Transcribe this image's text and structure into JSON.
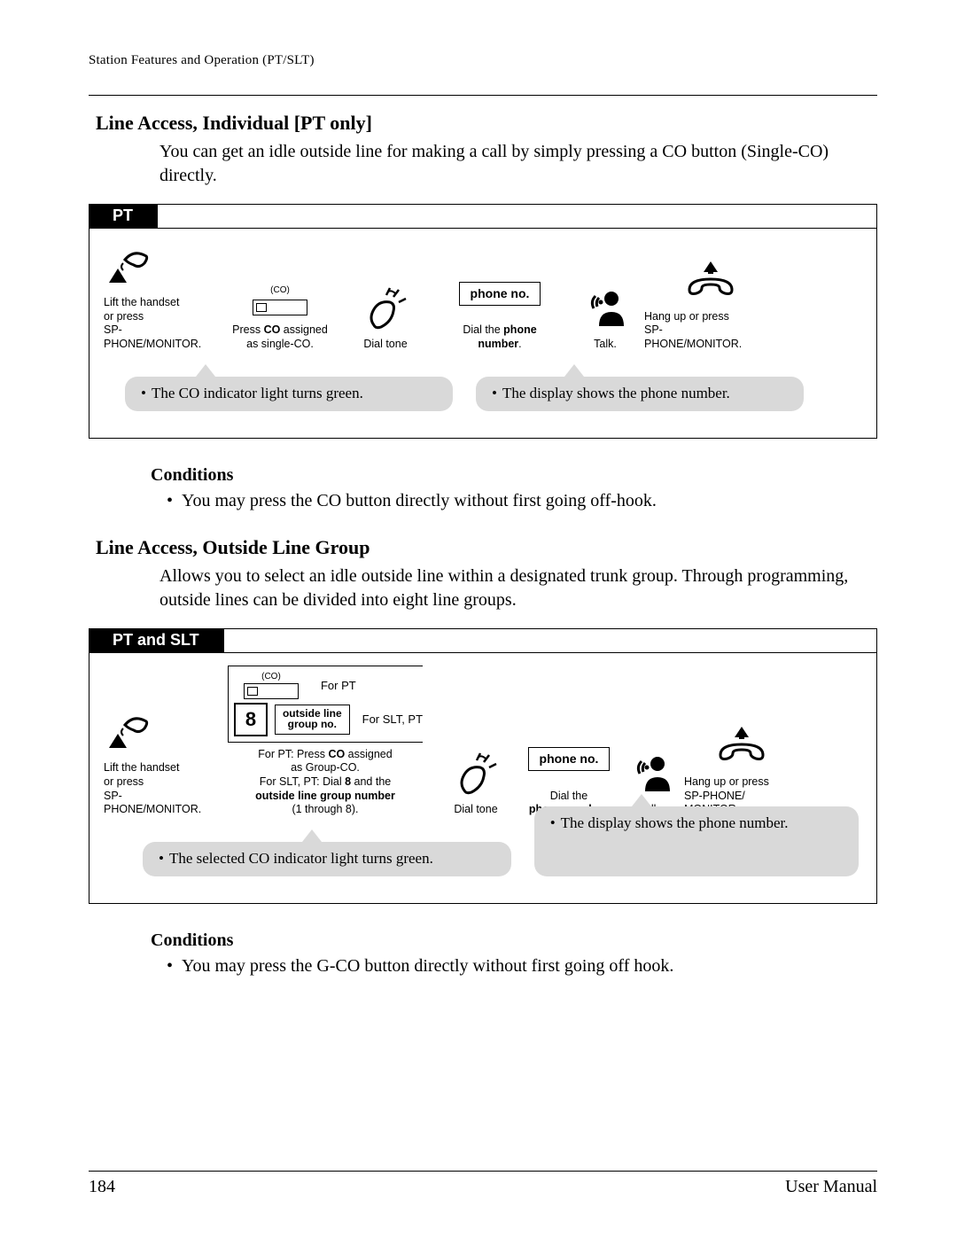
{
  "runhead": "Station Features and Operation (PT/SLT)",
  "sec1": {
    "title": "Line Access, Individual [PT only]",
    "intro": "You can get an idle outside line for making a call by simply pressing a CO button (Single-CO) directly.",
    "tab": "PT",
    "steps": {
      "co_label": "(CO)",
      "s1a": "Lift the handset",
      "s1b": "or press",
      "s1c": "SP-PHONE/MONITOR.",
      "s2a": "Press ",
      "s2a_b": "CO",
      "s2a2": " assigned",
      "s2b": "as single-CO.",
      "s3": "Dial tone",
      "phone_box": "phone no.",
      "s4a": "Dial the ",
      "s4a_b": "phone number",
      "s4a2": ".",
      "s5": "Talk.",
      "s6a": "Hang up or press",
      "s6b": "SP-PHONE/MONITOR."
    },
    "note1": "The CO indicator light turns green.",
    "note2": "The display shows the phone number.",
    "cond_h": "Conditions",
    "cond1": "You may press the CO button directly without first going off-hook."
  },
  "sec2": {
    "title": "Line Access, Outside Line Group",
    "intro": "Allows you to select an idle outside line within a designated trunk group. Through programming, outside lines can be divided into eight line groups.",
    "tab": "PT and SLT",
    "steps": {
      "co_label": "(CO)",
      "pt_tag": "For PT",
      "eight": "8",
      "olg1": "outside line",
      "olg2": "group no.",
      "slt_tag": "For SLT, PT",
      "s1a": "Lift the handset",
      "s1b": "or press",
      "s1c": "SP-PHONE/MONITOR.",
      "s2a": "For PT: Press ",
      "s2a_b": "CO",
      "s2a2": " assigned",
      "s2b": "as Group-CO.",
      "s2c": "For SLT, PT: Dial ",
      "s2c_b": "8",
      "s2c2": " and the",
      "s2d_b": "outside line group number",
      "s2e": "(1 through 8).",
      "s3": "Dial tone",
      "phone_box": "phone no.",
      "s4a": "Dial the",
      "s4b_b": "phone number",
      "s4b2": ".",
      "s5": "Talk.",
      "s6a": "Hang up or press",
      "s6b": "SP-PHONE/",
      "s6c": "MONITOR."
    },
    "note1": "The selected CO indicator light turns green.",
    "note2": "The display shows the phone number.",
    "cond_h": "Conditions",
    "cond1": "You may press the G-CO button directly without first going off hook."
  },
  "footer": {
    "page": "184",
    "doc": "User Manual"
  }
}
